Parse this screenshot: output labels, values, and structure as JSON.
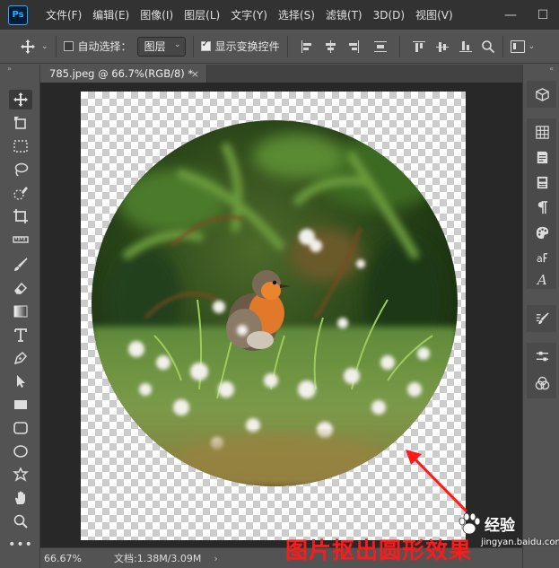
{
  "app": {
    "logo_text": "Ps"
  },
  "menu": [
    "文件(F)",
    "编辑(E)",
    "图像(I)",
    "图层(L)",
    "文字(Y)",
    "选择(S)",
    "滤镜(T)",
    "3D(D)",
    "视图(V)"
  ],
  "window_controls": {
    "minimize": "—",
    "maximize": "☐"
  },
  "options": {
    "auto_select_label": "自动选择：",
    "auto_select_checked": false,
    "layer_select_value": "图层",
    "show_transform_label": "显示变换控件",
    "show_transform_checked": true
  },
  "document_tab": {
    "title": "785.jpeg @ 66.7%(RGB/8) *",
    "close": "×"
  },
  "status": {
    "zoom": "66.67%",
    "doc_size": "文档:1.38M/3.09M",
    "arrow": "›"
  },
  "annotation": {
    "text": "图片抠出圆形效果",
    "color": "#ff1a1a"
  },
  "watermark": {
    "brand": "经验",
    "url": "jingyan.baidu.com"
  },
  "colors": {
    "menubar": "#323232",
    "panel": "#535353",
    "workspace": "#282828",
    "accent": "#31a8ff"
  },
  "toolbar_icons": [
    "move-icon",
    "artboard-icon",
    "marquee-icon",
    "lasso-icon",
    "quick-select-icon",
    "crop-icon",
    "ruler-icon",
    "brush-icon",
    "eraser-icon",
    "gradient-icon",
    "type-icon",
    "pen-icon",
    "path-select-icon",
    "rectangle-icon",
    "rounded-rect-icon",
    "ellipse-icon",
    "custom-shape-icon",
    "hand-icon",
    "zoom-icon",
    "more-icon"
  ],
  "right_panel_icons": [
    "3d-icon",
    "swatches-icon",
    "notes-icon",
    "properties-icon",
    "paragraph-icon",
    "color-icon",
    "glyphs-icon",
    "character-icon",
    "brush-settings-icon",
    "adjustments-icon",
    "channels-icon"
  ]
}
